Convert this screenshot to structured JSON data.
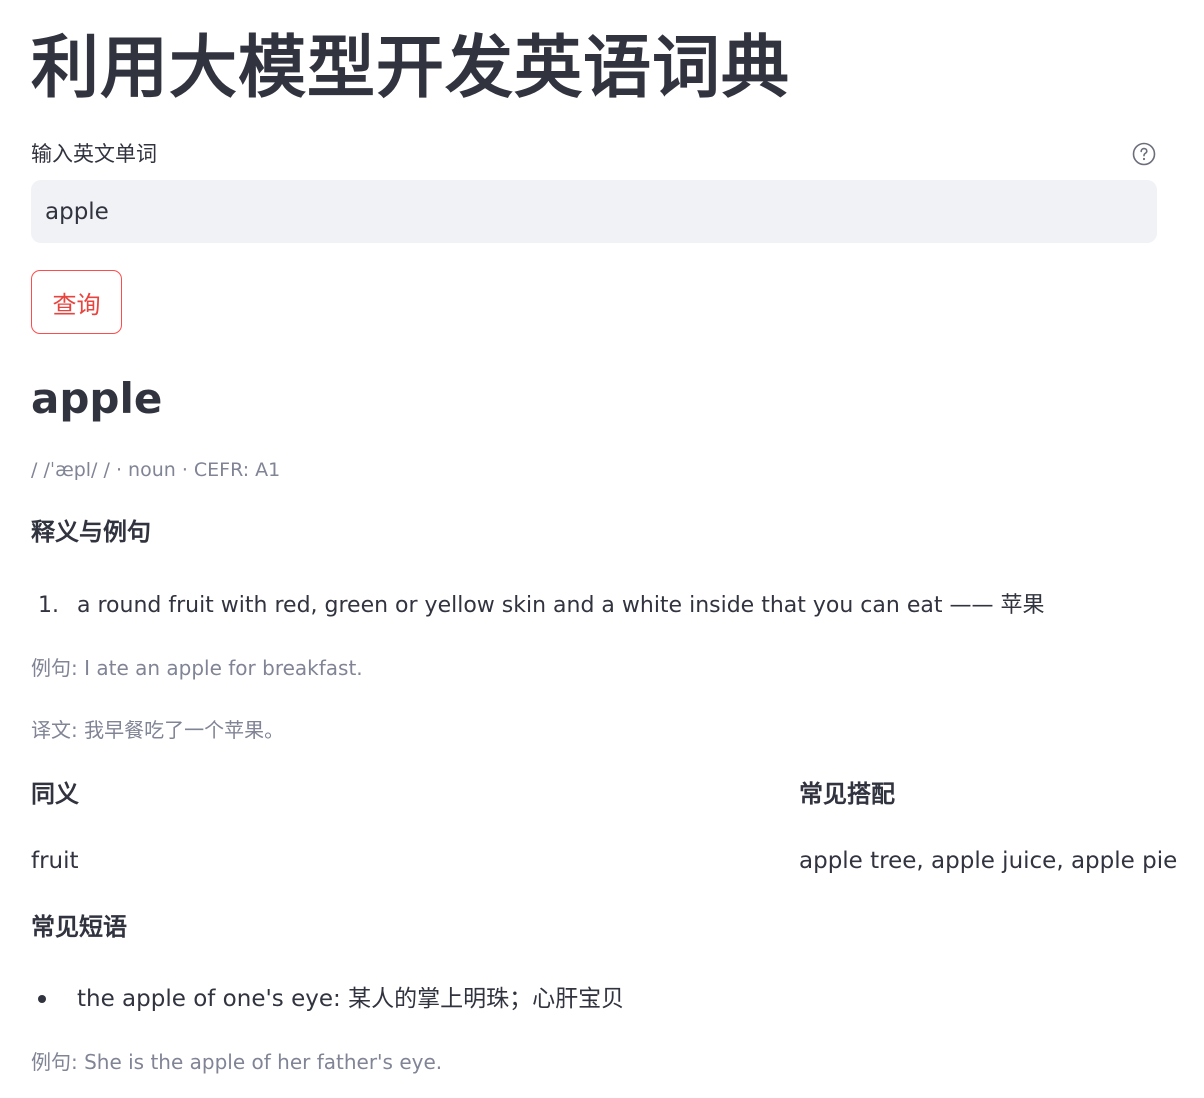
{
  "page": {
    "title": "利用大模型开发英语词典"
  },
  "search": {
    "label": "输入英文单词",
    "value": "apple",
    "help_icon": "question-circle-icon",
    "button_label": "查询"
  },
  "result": {
    "word": "apple",
    "meta": "/ /ˈæpl/ / · noun · CEFR: A1",
    "definitions_title": "释义与例句",
    "definitions": [
      {
        "number": "1.",
        "text": "a round fruit with red, green or yellow skin and a white inside that you can eat —— 苹果",
        "example": "例句: I ate an apple for breakfast.",
        "translation": "译文: 我早餐吃了一个苹果。"
      }
    ],
    "synonyms_title": "同义",
    "synonyms": "fruit",
    "collocations_title": "常见搭配",
    "collocations": "apple tree, apple juice, apple pie",
    "phrases_title": "常见短语",
    "phrases": [
      {
        "text": "the apple of one's eye: 某人的掌上明珠；心肝宝贝",
        "example": "例句: She is the apple of her father's eye."
      }
    ]
  },
  "colors": {
    "accent": "#ff4b4b",
    "text": "#31333f",
    "muted": "#808495",
    "input_bg": "#f0f2f6"
  }
}
